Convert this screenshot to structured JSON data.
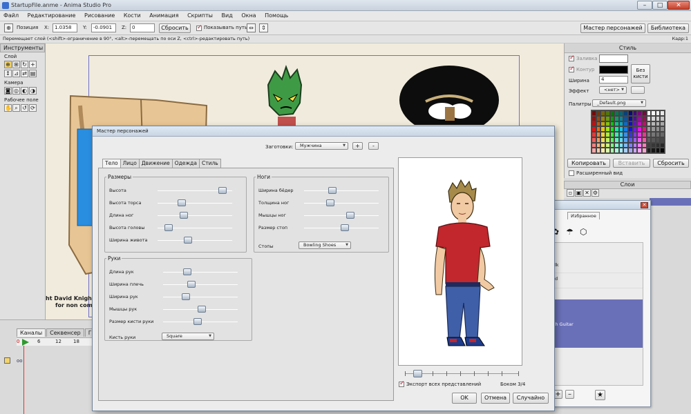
{
  "window": {
    "title": "StartupFile.anme - Anima Studio Pro",
    "min": "–",
    "max": "□",
    "close": "✕"
  },
  "menu": [
    "Файл",
    "Редактирование",
    "Рисование",
    "Кости",
    "Анимация",
    "Скрипты",
    "Вид",
    "Окна",
    "Помощь"
  ],
  "toolbar": {
    "position_label": "Позиция",
    "x_label": "X:",
    "x_value": "1.0358",
    "y_label": "Y:",
    "y_value": "-0.0901",
    "z_label": "Z:",
    "z_value": "0",
    "reset_label": "Сбросить",
    "show_path_label": "Показывать путь",
    "character_wizard_label": "Мастер персонажей",
    "library_label": "Библиотека"
  },
  "hint": {
    "text": "Перемещает слой (<shift>-ограничение в 90°, <alt>-перемещать по оси Z, <ctrl>-редактировать путь)",
    "frame": "Кадр:1"
  },
  "tools": {
    "title": "Инструменты",
    "groups": [
      {
        "label": "Слой"
      },
      {
        "label": "Камера"
      },
      {
        "label": "Рабочее поле"
      }
    ]
  },
  "canvas": {
    "credit_line1": "ht David Knight -",
    "credit_line2": "for non comme"
  },
  "timeline": {
    "tabs": [
      "Каналы",
      "Секвенсер",
      "Гра"
    ],
    "ruler": [
      "0",
      "6",
      "12",
      "18"
    ]
  },
  "style": {
    "title": "Стиль",
    "fill_label": "Заливка",
    "outline_label": "Контур",
    "width_label": "Ширина",
    "width_value": "4",
    "no_brush_line1": "Без",
    "no_brush_line2": "кисти",
    "effect_label": "Эффект",
    "effect_value": "<нет>",
    "palettes_label": "Палитры",
    "palette_value": "_Default.png",
    "copy_label": "Копировать",
    "paste_label": "Вставить",
    "reset_label": "Сбросить",
    "advanced_label": "Расширенный вид",
    "layers_title": "Слои",
    "fill_color": "#ffffff",
    "outline_color": "#000000"
  },
  "library": {
    "favorites_tab": "Избранное",
    "items": [
      "alk",
      "ed",
      "ith Guitar"
    ],
    "add": "+",
    "remove": "–"
  },
  "dialog": {
    "title": "Мастер персонажей",
    "presets_label": "Заготовки:",
    "preset_value": "Мужчина",
    "add_preset": "+",
    "remove_preset": "-",
    "tabs": [
      "Тело",
      "Лицо",
      "Движение",
      "Одежда",
      "Стиль"
    ],
    "sizes_title": "Размеры",
    "sizes": [
      {
        "label": "Высота",
        "value": 0.92
      },
      {
        "label": "Высота торса",
        "value": 0.3
      },
      {
        "label": "Длина ног",
        "value": 0.33
      },
      {
        "label": "Высота головы",
        "value": 0.1
      },
      {
        "label": "Ширина живота",
        "value": 0.4
      }
    ],
    "legs_title": "Ноги",
    "legs": [
      {
        "label": "Ширина бёдер",
        "value": 0.36
      },
      {
        "label": "Толщина ног",
        "value": 0.33
      },
      {
        "label": "Мышцы ног",
        "value": 0.64
      },
      {
        "label": "Размер стоп",
        "value": 0.55
      }
    ],
    "feet_label": "Стопы",
    "feet_value": "Bowling Shoes",
    "arms_title": "Руки",
    "arms": [
      {
        "label": "Длина рук",
        "value": 0.3
      },
      {
        "label": "Ширина плечь",
        "value": 0.36
      },
      {
        "label": "Ширина рук",
        "value": 0.28
      },
      {
        "label": "Мышцы рук",
        "value": 0.52
      },
      {
        "label": "Размер кисти руки",
        "value": 0.46
      }
    ],
    "hand_label": "Кисть руки",
    "hand_value": "Square",
    "export_label": "Экспорт всех представлений",
    "view_status": "Боком 3/4",
    "ok_label": "OK",
    "cancel_label": "Отмена",
    "random_label": "Случайно"
  },
  "colors": {
    "accent_thumb": "#aab8c8",
    "selection": "#6a70b8",
    "frame_border": "#6e6ec9"
  }
}
